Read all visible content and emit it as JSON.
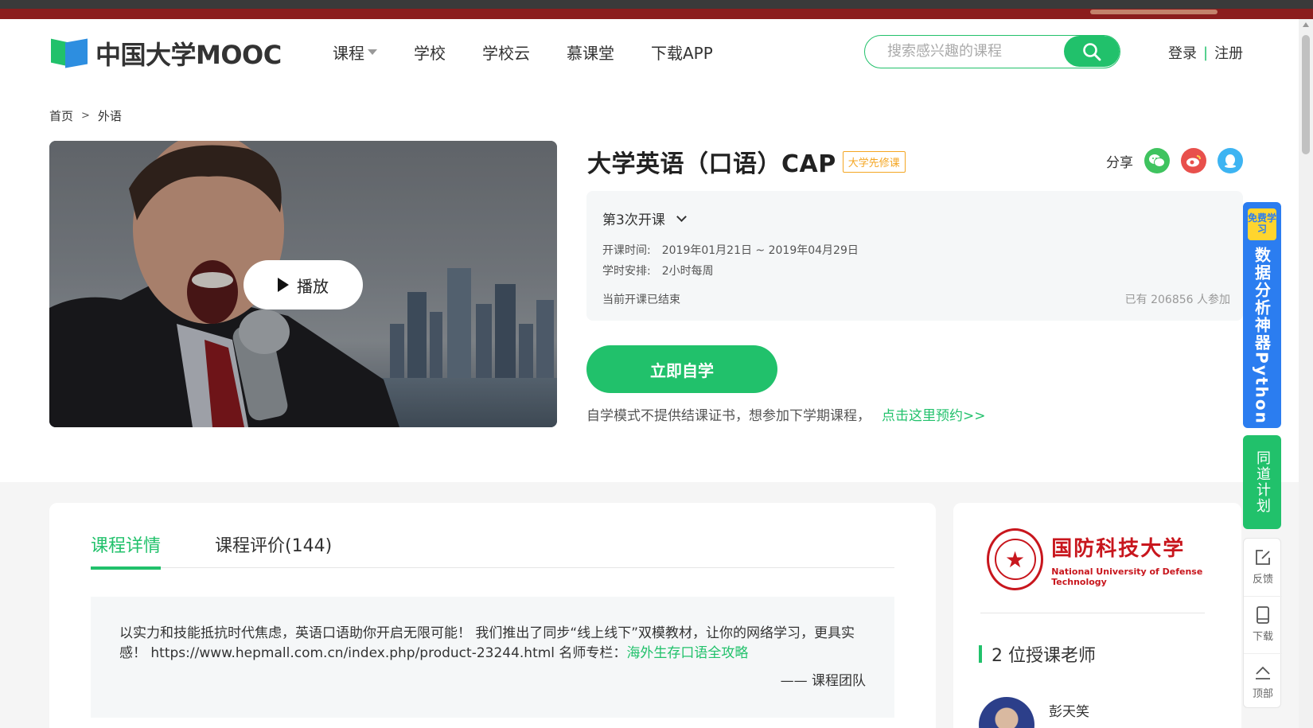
{
  "header": {
    "logo_text": "中国大学MOOC",
    "nav": [
      "课程",
      "学校",
      "学校云",
      "慕课堂",
      "下载APP"
    ],
    "search_placeholder": "搜索感兴趣的课程",
    "login": "登录",
    "divider": "|",
    "register": "注册"
  },
  "breadcrumb": {
    "home": "首页",
    "sep": ">",
    "current": "外语"
  },
  "video": {
    "play_label": "播放"
  },
  "course": {
    "title": "大学英语（口语）CAP",
    "tag": "大学先修课",
    "share_label": "分享",
    "share_icons": [
      "wechat-icon",
      "weibo-icon",
      "qq-icon"
    ],
    "term_select": "第3次开课",
    "time_label": "开课时间:",
    "time_value": "2019年01月21日 ~ 2019年04月29日",
    "hours_label": "学时安排:",
    "hours_value": "2小时每周",
    "status": "当前开课已结束",
    "participants": "已有 206856 人参加",
    "cta": "立即自学",
    "note": "自学模式不提供结课证书，想参加下学期课程，",
    "note_link": "点击这里预约>>"
  },
  "details": {
    "tabs": [
      "课程详情",
      "课程评价(144)"
    ],
    "text": "以实力和技能抵抗时代焦虑，英语口语助你开启无限可能！ 我们推出了同步“线上线下”双模教材，让你的网络学习，更具实感！ https://www.hepmall.com.cn/index.php/product-23244.html 名师专栏：",
    "link": "海外生存口语全攻略",
    "signature": "—— 课程团队"
  },
  "sidebar": {
    "university_cn": "国防科技大学",
    "university_en": "National University of Defense Technology",
    "teachers_heading": "2 位授课老师",
    "teacher_name": "彭天笑"
  },
  "float": {
    "ad_badge": "免费学习",
    "ad_text": "数据分析神器Python",
    "plan": "同道计划",
    "feedback": "反馈",
    "download": "下载",
    "top": "顶部"
  },
  "colors": {
    "accent": "#21c16b",
    "tag": "#f4a623",
    "ad": "#2b7df0",
    "university": "#c8161d"
  }
}
